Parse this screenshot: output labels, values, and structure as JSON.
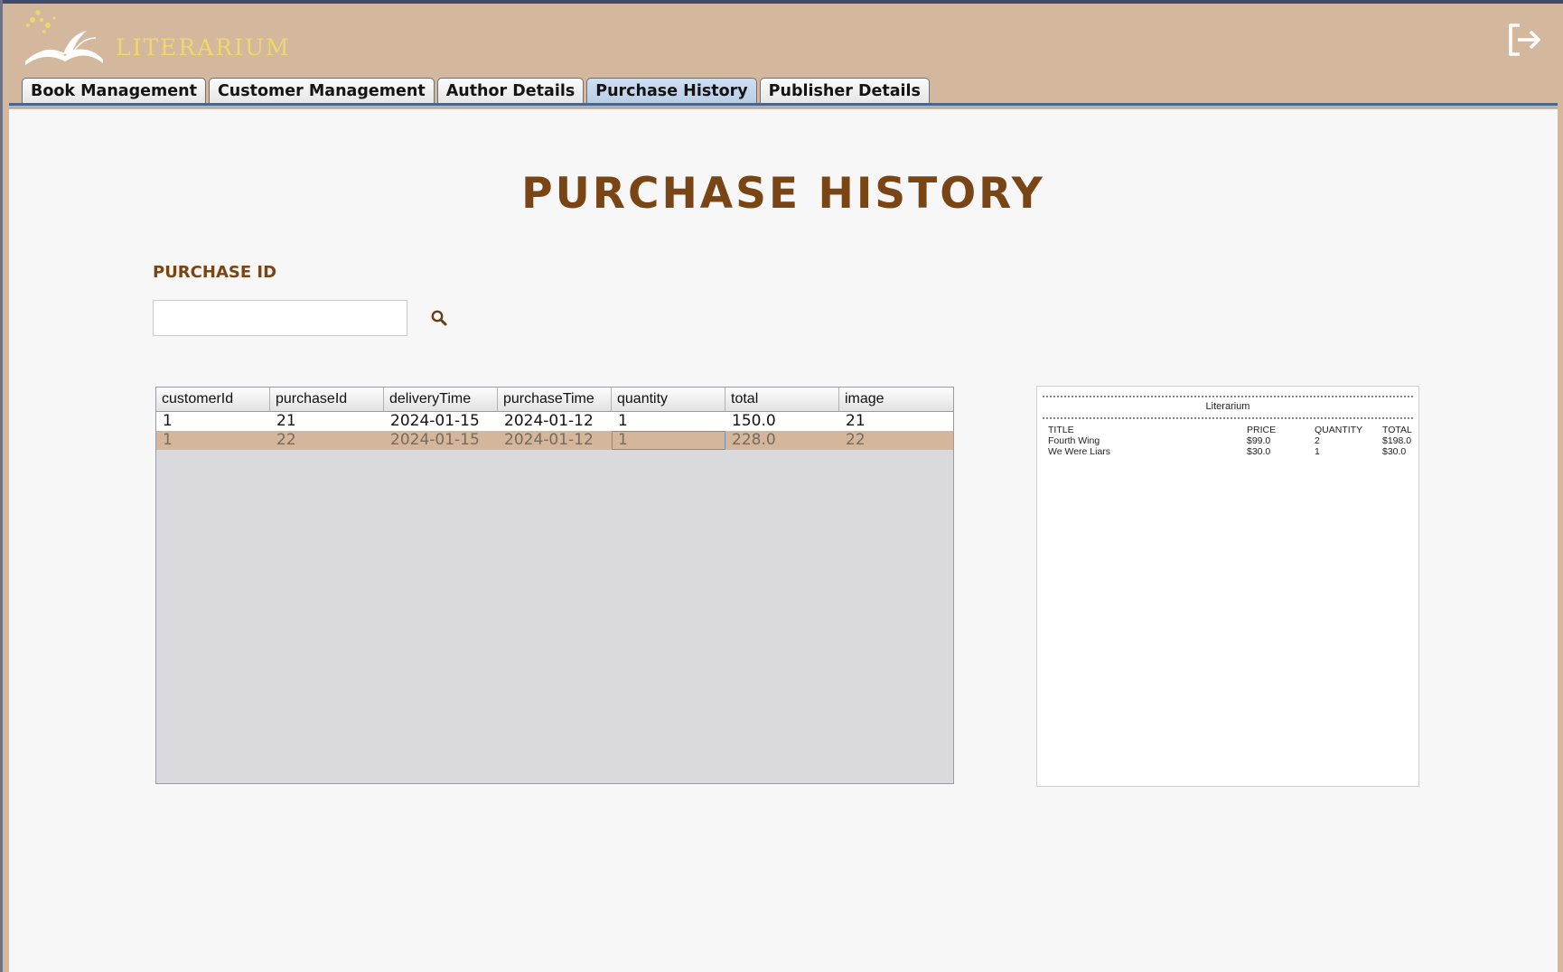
{
  "app": {
    "brand": "LITERARIUM"
  },
  "tabs": [
    {
      "label": "Book Management",
      "active": false
    },
    {
      "label": "Customer Management",
      "active": false
    },
    {
      "label": "Author Details",
      "active": false
    },
    {
      "label": "Purchase History",
      "active": true
    },
    {
      "label": "Publisher Details",
      "active": false
    }
  ],
  "page": {
    "title": "PURCHASE HISTORY",
    "search_label": "PURCHASE ID",
    "search_value": "",
    "search_placeholder": ""
  },
  "table": {
    "columns": [
      "customerId",
      "purchaseId",
      "deliveryTime",
      "purchaseTime",
      "quantity",
      "total",
      "image"
    ],
    "rows": [
      [
        "1",
        "21",
        "2024-01-15",
        "2024-01-12",
        "1",
        "150.0",
        "21"
      ],
      [
        "1",
        "22",
        "2024-01-15",
        "2024-01-12",
        "1",
        "228.0",
        "22"
      ]
    ],
    "selected_row": 1
  },
  "receipt": {
    "title": "Literarium",
    "headers": [
      "TITLE",
      "PRICE",
      "QUANTITY",
      "TOTAL"
    ],
    "items": [
      [
        "Fourth Wing",
        "$99.0",
        "2",
        "$198.0"
      ],
      [
        "We Were Liars",
        "$30.0",
        "1",
        "$30.0"
      ]
    ]
  },
  "icons": {
    "logo": "open-book-logo-icon",
    "logout": "logout-icon",
    "search": "search-icon"
  },
  "colors": {
    "header_bg": "#d4b89e",
    "brand_text": "#efd86a",
    "title_text": "#7a4515",
    "selected_row": "#d3b69b",
    "active_tab": "#c4d6ee"
  }
}
